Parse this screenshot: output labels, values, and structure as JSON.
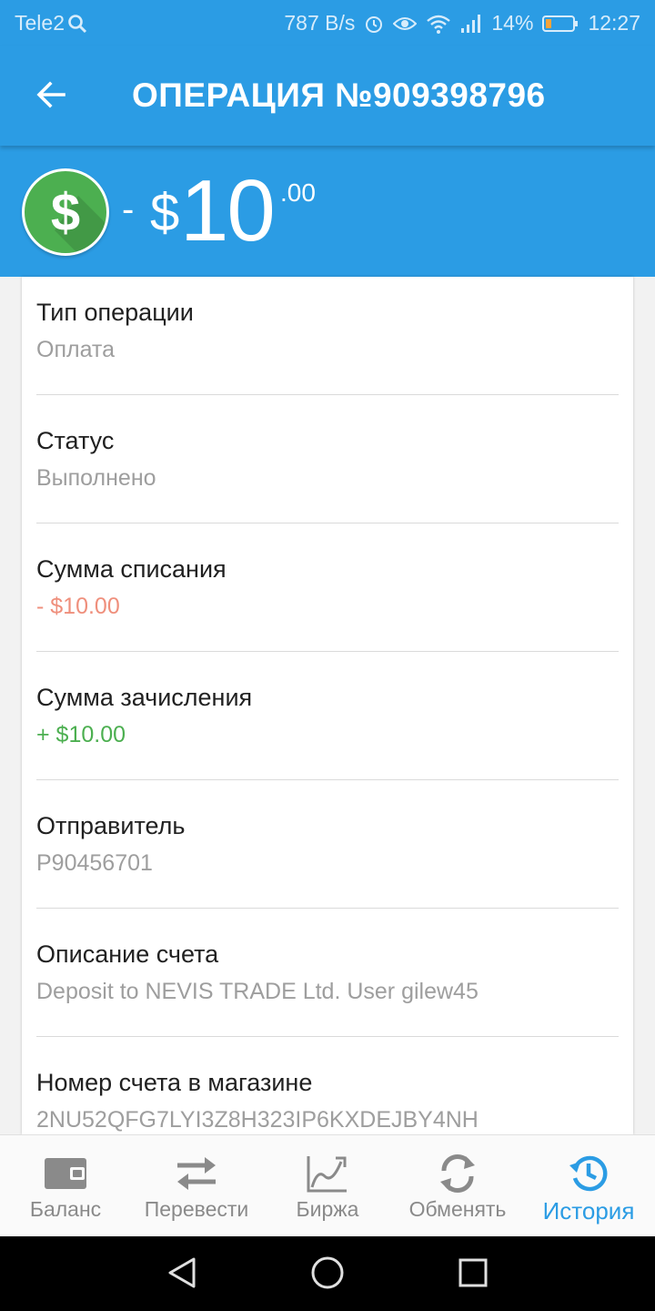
{
  "status_bar": {
    "carrier": "Tele2",
    "speed": "787 B/s",
    "battery": "14%",
    "time": "12:27"
  },
  "app_bar": {
    "title": "ОПЕРАЦИЯ №909398796"
  },
  "amount": {
    "sign": "-",
    "currency": "$",
    "main": "10",
    "cents": ".00",
    "icon": "dollar-icon",
    "icon_color": "#4caf50"
  },
  "details": [
    {
      "label": "Тип операции",
      "value": "Оплата"
    },
    {
      "label": "Статус",
      "value": "Выполнено"
    },
    {
      "label": "Сумма списания",
      "value": "- $10.00"
    },
    {
      "label": "Сумма зачисления",
      "value": "+ $10.00"
    },
    {
      "label": "Отправитель",
      "value": "P90456701"
    },
    {
      "label": "Описание счета",
      "value": "Deposit to NEVIS TRADE Ltd. User gilew45"
    },
    {
      "label": "Номер счета в магазине",
      "value": "2NU52QFG7LYI3Z8H323IP6KXDEJBY4NH"
    }
  ],
  "bottom_nav": [
    {
      "label": "Баланс",
      "icon": "wallet-icon",
      "active": false
    },
    {
      "label": "Перевести",
      "icon": "transfer-icon",
      "active": false
    },
    {
      "label": "Биржа",
      "icon": "chart-icon",
      "active": false
    },
    {
      "label": "Обменять",
      "icon": "exchange-icon",
      "active": false
    },
    {
      "label": "История",
      "icon": "history-icon",
      "active": true
    }
  ],
  "colors": {
    "primary": "#2b9ce4",
    "debit": "#ef8f7c",
    "credit": "#4caf50",
    "active_nav": "#2b9ce4"
  }
}
